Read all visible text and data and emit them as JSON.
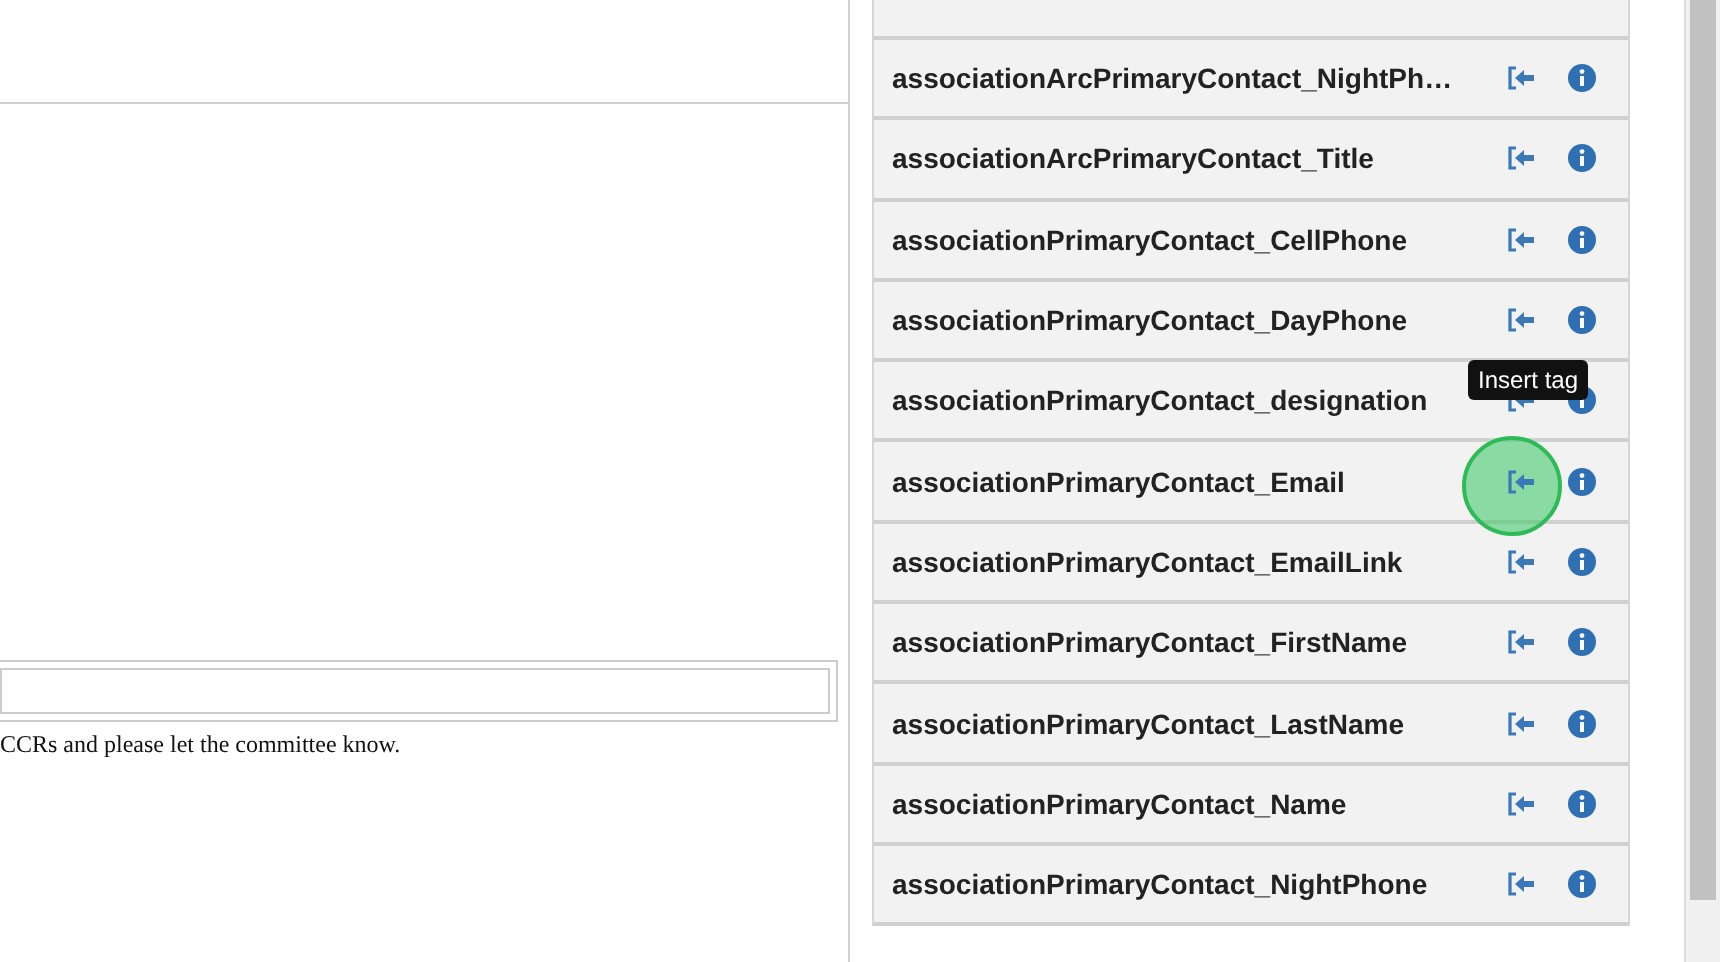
{
  "editor": {
    "note": "CCRs and please let the committee know."
  },
  "tags": [
    {
      "name": "associationArcPrimaryContact_NightPh…",
      "clicked": false
    },
    {
      "name": "associationArcPrimaryContact_Title",
      "clicked": false
    },
    {
      "name": "associationPrimaryContact_CellPhone",
      "clicked": false
    },
    {
      "name": "associationPrimaryContact_DayPhone",
      "clicked": false
    },
    {
      "name": "associationPrimaryContact_designation",
      "clicked": false
    },
    {
      "name": "associationPrimaryContact_Email",
      "clicked": true
    },
    {
      "name": "associationPrimaryContact_EmailLink",
      "clicked": false
    },
    {
      "name": "associationPrimaryContact_FirstName",
      "clicked": false
    },
    {
      "name": "associationPrimaryContact_LastName",
      "clicked": false
    },
    {
      "name": "associationPrimaryContact_Name",
      "clicked": false
    },
    {
      "name": "associationPrimaryContact_NightPhone",
      "clicked": false
    }
  ],
  "tooltip": {
    "text": "Insert tag"
  }
}
